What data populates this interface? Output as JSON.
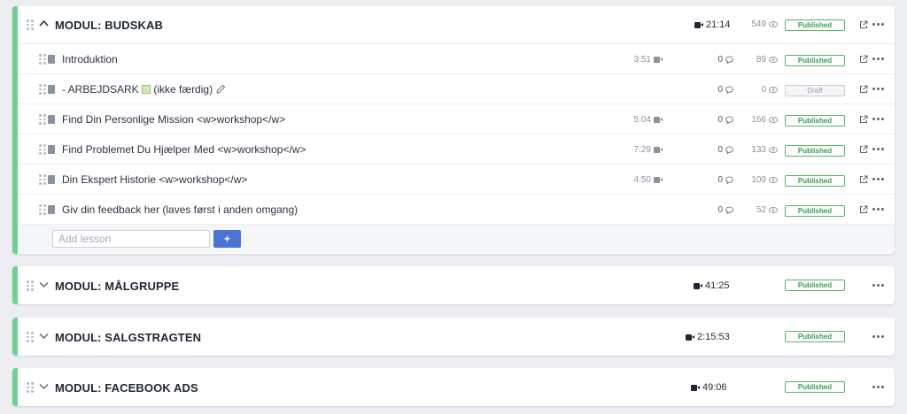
{
  "modules": [
    {
      "title": "MODUL: BUDSKAB",
      "expanded": true,
      "duration": "21:14",
      "views": "549",
      "status": "Published",
      "lessons": [
        {
          "title": "Introduktion",
          "duration": "3:51",
          "comments": "0",
          "views": "89",
          "status": "Published"
        },
        {
          "title": "- ARBEJDSARK",
          "title_suffix": "(ikke færdig)",
          "duration": "",
          "comments": "0",
          "views": "0",
          "status": "Draft"
        },
        {
          "title": "Find Din Personlige Mission <w>workshop</w>",
          "duration": "5:04",
          "comments": "0",
          "views": "166",
          "status": "Published"
        },
        {
          "title": "Find Problemet Du Hjælper Med <w>workshop</w>",
          "duration": "7:29",
          "comments": "0",
          "views": "133",
          "status": "Published"
        },
        {
          "title": "Din Ekspert Historie <w>workshop</w>",
          "duration": "4:50",
          "comments": "0",
          "views": "109",
          "status": "Published"
        },
        {
          "title": "Giv din feedback her (laves først i anden omgang)",
          "duration": "",
          "comments": "0",
          "views": "52",
          "status": "Published"
        }
      ],
      "add_lesson": {
        "placeholder": "Add lesson",
        "button": "+"
      }
    },
    {
      "title": "MODUL: MÅLGRUPPE",
      "expanded": false,
      "duration": "41:25",
      "status": "Published"
    },
    {
      "title": "MODUL: SALGSTRAGTEN",
      "expanded": false,
      "duration": "2:15:53",
      "status": "Published"
    },
    {
      "title": "MODUL: FACEBOOK ADS",
      "expanded": false,
      "duration": "49:06",
      "status": "Published"
    }
  ],
  "icons": {
    "drag": "drag-handle-icon",
    "chevron_up": "chevron-up-icon",
    "chevron_down": "chevron-down-icon",
    "video": "video-camera-icon",
    "eye": "eye-icon",
    "comment": "comment-bubble-icon",
    "external": "external-link-icon",
    "more": "more-dots-icon",
    "lesson": "lesson-document-icon",
    "edit": "pencil-icon"
  },
  "colors": {
    "accent_border": "#6fcf97",
    "published": "#3c9a52",
    "add_button": "#4a73d4"
  }
}
